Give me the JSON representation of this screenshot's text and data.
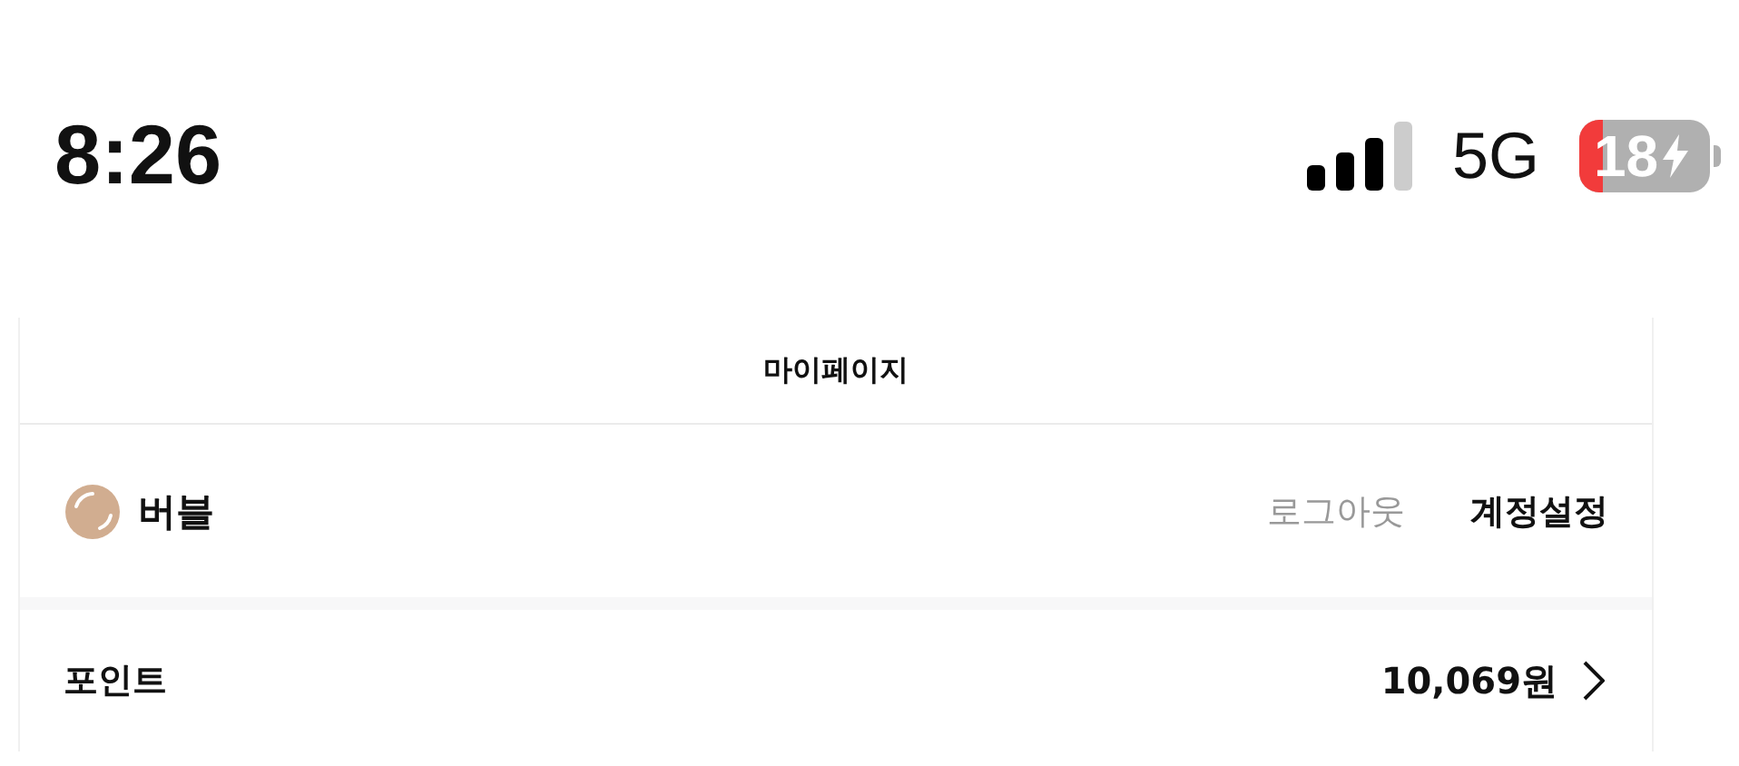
{
  "status_bar": {
    "time": "8:26",
    "network": "5G",
    "battery": "18"
  },
  "header": {
    "title": "마이페이지"
  },
  "profile": {
    "name": "버블",
    "logout": "로그아웃",
    "settings": "계정설정"
  },
  "points": {
    "label": "포인트",
    "value": "10,069원"
  }
}
